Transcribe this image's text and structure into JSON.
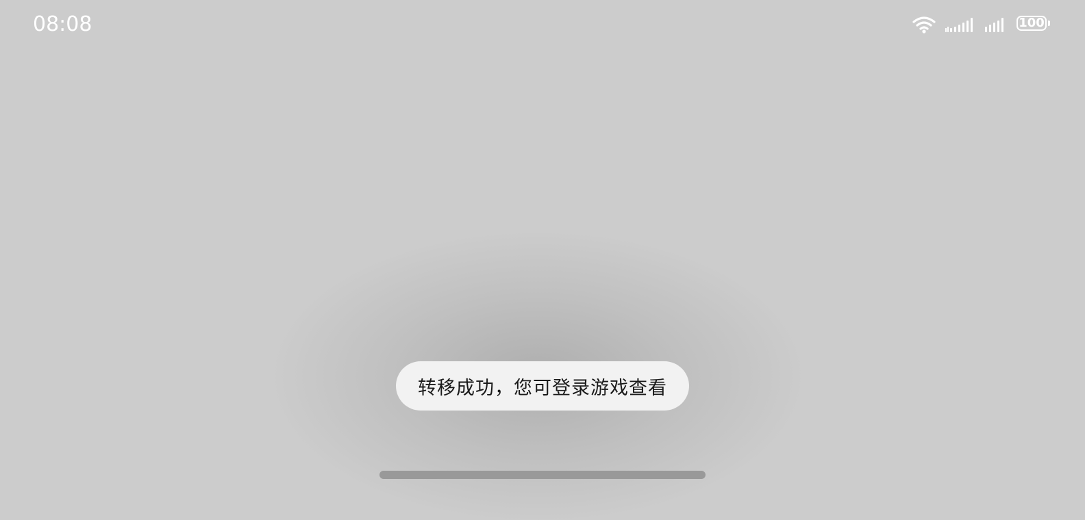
{
  "status_bar": {
    "time": "08:08",
    "battery_level": "100",
    "icons": [
      "wifi-icon",
      "cellular-signal-icon",
      "cellular-signal-icon",
      "battery-icon"
    ]
  },
  "toast": {
    "message": "转移成功，您可登录游戏查看"
  },
  "colors": {
    "background": "#cccccc",
    "toast_background": "#f2f2f2",
    "toast_text": "#1a1a1a",
    "status_text": "#ffffff",
    "home_indicator": "#999999"
  }
}
